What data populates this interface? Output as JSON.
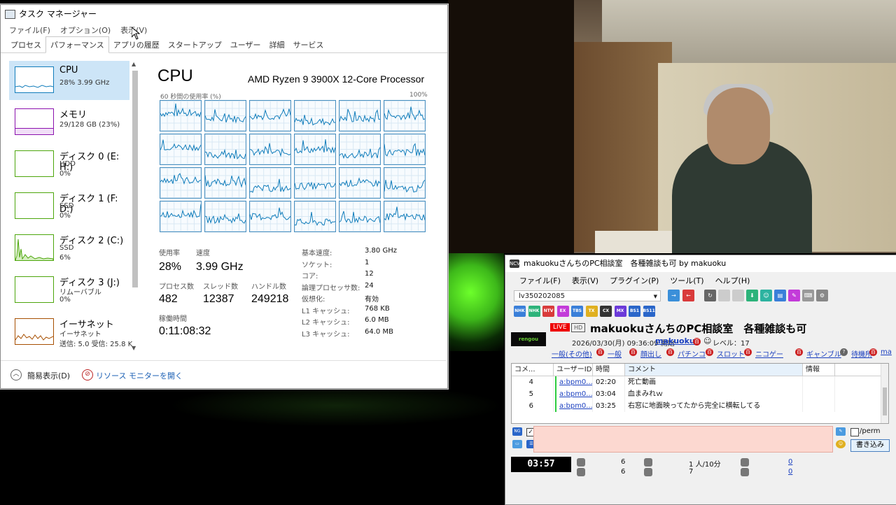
{
  "taskmgr": {
    "title": "タスク マネージャー",
    "menu": [
      "ファイル(F)",
      "オプション(O)",
      "表示(V)"
    ],
    "tabs": [
      "プロセス",
      "パフォーマンス",
      "アプリの履歴",
      "スタートアップ",
      "ユーザー",
      "詳細",
      "サービス"
    ],
    "active_tab": "パフォーマンス",
    "sidebar": [
      {
        "title": "CPU",
        "line1": "28%  3.99 GHz",
        "line2": "",
        "color": "#117dbb"
      },
      {
        "title": "メモリ",
        "line1": "29/128 GB (23%)",
        "line2": "",
        "color": "#8b12ae"
      },
      {
        "title": "ディスク 0 (E: H:)",
        "line1": "HDD",
        "line2": "0%",
        "color": "#4da60c"
      },
      {
        "title": "ディスク 1 (F: D:)",
        "line1": "SSD",
        "line2": "0%",
        "color": "#4da60c"
      },
      {
        "title": "ディスク 2 (C:)",
        "line1": "SSD",
        "line2": "6%",
        "color": "#4da60c"
      },
      {
        "title": "ディスク 3 (J:)",
        "line1": "リムーバブル",
        "line2": "0%",
        "color": "#4da60c"
      },
      {
        "title": "イーサネット",
        "line1": "イーサネット",
        "line2": "送信: 5.0  受信: 25.8 K",
        "color": "#a74f01"
      }
    ],
    "detail": {
      "heading": "CPU",
      "processor": "AMD Ryzen 9 3900X 12-Core Processor",
      "axis_left": "60 秒間の使用率 (%)",
      "axis_right": "100%",
      "labels": {
        "usage": "使用率",
        "speed": "速度",
        "processes": "プロセス数",
        "threads": "スレッド数",
        "handles": "ハンドル数",
        "uptime": "稼働時間"
      },
      "values": {
        "usage": "28%",
        "speed": "3.99 GHz",
        "processes": "482",
        "threads": "12387",
        "handles": "249218",
        "uptime": "0:11:08:32"
      },
      "specs": [
        {
          "k": "基本速度:",
          "v": "3.80 GHz"
        },
        {
          "k": "ソケット:",
          "v": "1"
        },
        {
          "k": "コア:",
          "v": "12"
        },
        {
          "k": "論理プロセッサ数:",
          "v": "24"
        },
        {
          "k": "仮想化:",
          "v": "有効"
        },
        {
          "k": "L1 キャッシュ:",
          "v": "768 KB"
        },
        {
          "k": "L2 キャッシュ:",
          "v": "6.0 MB"
        },
        {
          "k": "L3 キャッシュ:",
          "v": "64.0 MB"
        }
      ]
    },
    "footer": {
      "summary": "簡易表示(D)",
      "resmon": "リソース モニターを開く"
    }
  },
  "viewer": {
    "title": "makuokuさんちのPC相談室　各種雑談も可 by makuoku",
    "menu": [
      "ファイル(F)",
      "表示(V)",
      "プラグイン(P)",
      "ツール(T)",
      "ヘルプ(H)"
    ],
    "lv_id": "lv350202085",
    "channels": [
      "NHK",
      "NHK",
      "NTV",
      "EX",
      "TBS",
      "TX",
      "CX",
      "MX",
      "BS1",
      "BS11"
    ],
    "thumb_text": "rengou",
    "live_badge": "LIVE",
    "hd_badge": "HD",
    "broadcast_title": "makuokuさんちのPC相談室　各種雑談も可",
    "date": "2026/03/30(月) 09:36:09 開始",
    "user": "makuoku",
    "level": "レベル：17",
    "categories": [
      "一般(その他)",
      "一般",
      "顔出し",
      "パチンコ",
      "スロット",
      "ニコゲー",
      "ギャンブル",
      "待機所",
      "ma"
    ],
    "table_headers": [
      "コメ...",
      "ユーザーID",
      "時間",
      "コメント",
      "情報"
    ],
    "comments": [
      {
        "no": "4",
        "uid": "a:bpm0...",
        "time": "02:20",
        "text": "死亡動画"
      },
      {
        "no": "5",
        "uid": "a:bpm0...",
        "time": "03:04",
        "text": "血まみれｗ"
      },
      {
        "no": "6",
        "uid": "a:bpm0...",
        "time": "03:25",
        "text": "右窓に地面映ってたから完全に横転してる"
      }
    ],
    "input": {
      "unei_label": "運営",
      "perm_label": "/perm",
      "post_button": "書き込み",
      "ng_icon": "NG",
      "kanji_184": "184"
    },
    "timer": "03:57",
    "stats": {
      "comments_a": "6",
      "comments_b": "6",
      "viewers_a": "1 人/10分",
      "viewers_b": "7",
      "ads_a": "0",
      "ads_b": "0"
    }
  }
}
